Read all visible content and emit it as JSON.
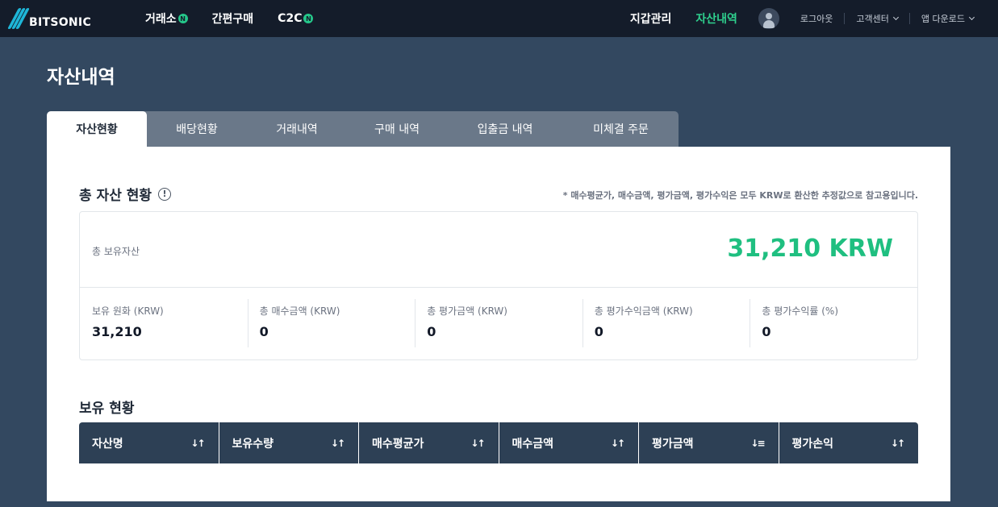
{
  "header": {
    "logo_text": "BITSONIC",
    "nav": [
      {
        "label": "거래소",
        "badge": "N"
      },
      {
        "label": "간편구매",
        "badge": ""
      },
      {
        "label": "C2C",
        "badge": "N"
      }
    ],
    "wallet": "지갑관리",
    "assets": "자산내역",
    "logout": "로그아웃",
    "support": "고객센터",
    "app_download": "앱 다운로드",
    "accent_color": "#2fd08e"
  },
  "page": {
    "title": "자산내역"
  },
  "tabs": [
    "자산현황",
    "배당현황",
    "거래내역",
    "구매 내역",
    "입출금 내역",
    "미체결 주문"
  ],
  "summary": {
    "title": "총 자산 현황",
    "note": "* 매수평균가, 매수금액, 평가금액, 평가수익은 모두 KRW로 환산한 추정값으로 참고용입니다.",
    "total_label": "총 보유자산",
    "total_value": "31,210 KRW",
    "cols": [
      {
        "label": "보유 원화 (KRW)",
        "value": "31,210"
      },
      {
        "label": "총 매수금액 (KRW)",
        "value": "0"
      },
      {
        "label": "총 평가금액 (KRW)",
        "value": "0"
      },
      {
        "label": "총 평가수익금액 (KRW)",
        "value": "0"
      },
      {
        "label": "총 평가수익률 (%)",
        "value": "0"
      }
    ]
  },
  "holdings": {
    "title": "보유 현황",
    "columns": [
      "자산명",
      "보유수량",
      "매수평균가",
      "매수금액",
      "평가금액",
      "평가손익"
    ]
  }
}
